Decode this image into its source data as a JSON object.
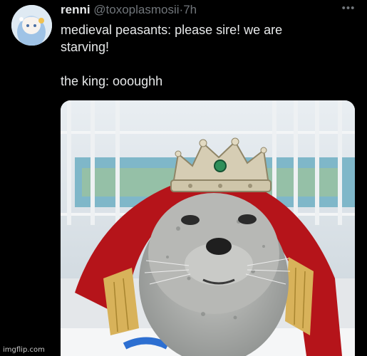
{
  "tweet": {
    "author_name": "renni",
    "handle": "@toxoplasmosii",
    "separator": "·",
    "time": "7h",
    "more_label": "•••",
    "lines": [
      "medieval peasants: please sire! we are",
      "starving!"
    ],
    "punchline": "the king: oooughh"
  },
  "media": {
    "description_icon": "seal-with-crown-photo"
  },
  "watermark": "imgflip.com",
  "colors": {
    "background": "#000000",
    "text": "#e7e9ea",
    "muted": "#71767b",
    "cape": "#b5141a",
    "crown": "#d6cdb4",
    "gem": "#2f8f5a"
  }
}
